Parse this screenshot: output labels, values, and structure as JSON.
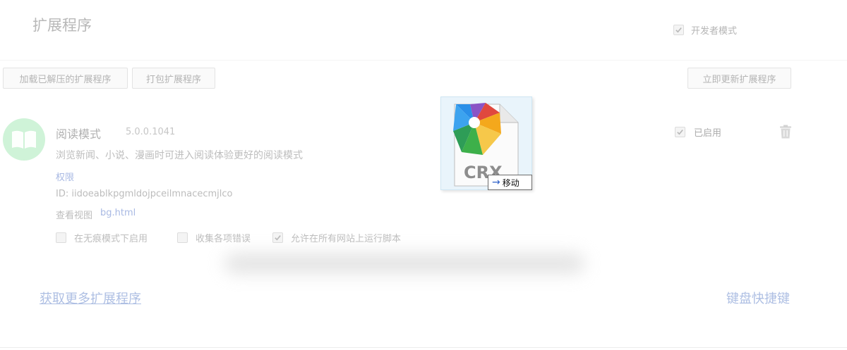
{
  "page": {
    "title": "扩展程序"
  },
  "developer_mode": {
    "label": "开发者模式",
    "checked": true
  },
  "toolbar": {
    "load_unpacked": "加载已解压的扩展程序",
    "pack": "打包扩展程序",
    "update_now": "立即更新扩展程序"
  },
  "extension": {
    "icon": "open-book-icon",
    "name": "阅读模式",
    "version": "5.0.0.1041",
    "description": "浏览新闻、小说、漫画时可进入阅读体验更好的阅读模式",
    "permissions_link": "权限",
    "id_text": "ID: iidoeablkpgmldojpceilmnacecmjlco",
    "inspect_label": "查看视图",
    "inspect_link": "bg.html",
    "enabled_label": "已启用",
    "enabled": true,
    "options": [
      {
        "label": "在无痕模式下启用",
        "checked": false
      },
      {
        "label": "收集各项错误",
        "checked": false
      },
      {
        "label": "允许在所有网站上运行脚本",
        "checked": true
      }
    ]
  },
  "footer": {
    "get_more": "获取更多扩展程序",
    "keyboard_shortcuts": "键盘快捷键"
  },
  "drag": {
    "file_label": "CRX",
    "action_label": "移动",
    "action_icon": "arrow-right-icon"
  },
  "colors": {
    "link": "#a8b9e3",
    "icon_bg": "#cff3d8",
    "move_arrow": "#2c5fc8"
  }
}
